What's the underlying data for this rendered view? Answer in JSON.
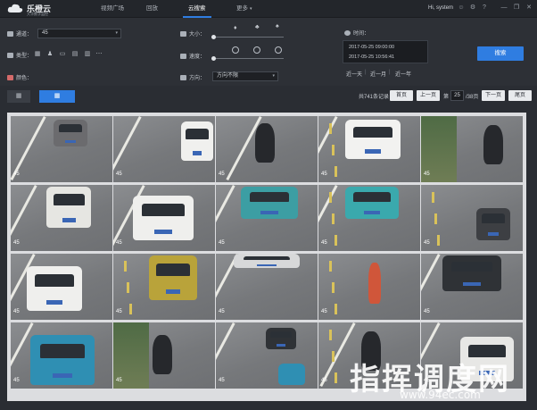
{
  "app": {
    "brand_name": "乐橙云",
    "brand_sub": "大华数字监控",
    "nav": [
      {
        "label": "视频广场"
      },
      {
        "label": "回放"
      },
      {
        "label": "云搜索"
      },
      {
        "label": "更多"
      }
    ],
    "active_nav": "云搜索",
    "user": "Hi, system"
  },
  "filters": {
    "channel_label": "通道：",
    "channel_value": "45",
    "type_label": "类型：",
    "color_label": "颜色：",
    "size_label": "大小：",
    "speed_label": "速度：",
    "direction_label": "方向：",
    "direction_value": "方向不限",
    "time_label": "时间：",
    "time_start": "2017-05-25 09:00:00",
    "time_end": "2017-05-25 10:56:41",
    "quick_ranges": [
      "近一天",
      "近一月",
      "近一年"
    ],
    "search_button": "搜索",
    "colors": [
      "#e23b3b",
      "#f08a1e",
      "#f2d21e",
      "#2fb34a",
      "#21b0c9",
      "#2b62d9",
      "#9b39c9",
      "#ffffff",
      "#111111",
      "#8a8d91"
    ]
  },
  "toolbar": {
    "total_text": "共741条记录",
    "first_page": "首页",
    "prev_page": "上一页",
    "page_prefix": "第",
    "current_page": "25",
    "page_total": "/38页",
    "next_page": "下一页",
    "last_page": "尾页"
  },
  "results": {
    "channel_badge": "45"
  },
  "watermark": {
    "title": "指挥调度网",
    "url": "www.94ec.com"
  }
}
